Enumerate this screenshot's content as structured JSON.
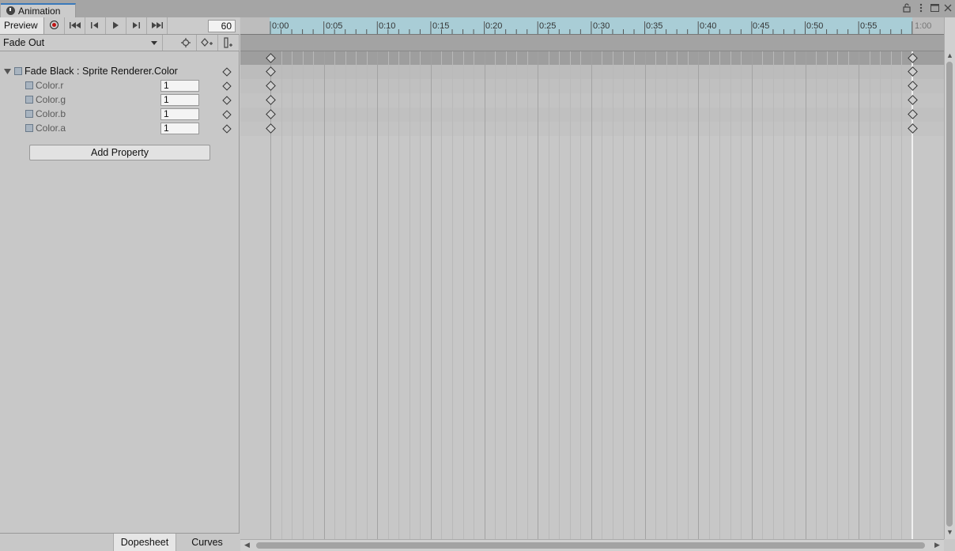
{
  "window": {
    "tab_label": "Animation",
    "tab_icon": "animation-clock-icon"
  },
  "toolbar": {
    "preview_label": "Preview",
    "frame_value": "60",
    "icons": [
      "record-icon",
      "first-keyframe-icon",
      "prev-keyframe-icon",
      "play-icon",
      "next-keyframe-icon",
      "last-keyframe-icon"
    ]
  },
  "clip": {
    "selected": "Fade Out"
  },
  "properties": {
    "group_label": "Fade Black : Sprite Renderer.Color",
    "items": [
      {
        "label": "Color.r",
        "value": "1"
      },
      {
        "label": "Color.g",
        "value": "1"
      },
      {
        "label": "Color.b",
        "value": "1"
      },
      {
        "label": "Color.a",
        "value": "1"
      }
    ],
    "add_label": "Add Property"
  },
  "bottom_tabs": {
    "dopesheet": "Dopesheet",
    "curves": "Curves"
  },
  "timeline": {
    "tick_labels": [
      "0:00",
      "0:05",
      "0:10",
      "0:15",
      "0:20",
      "0:25",
      "0:30",
      "0:35",
      "0:40",
      "0:45",
      "0:50",
      "0:55",
      "1:00"
    ],
    "keyframe_times": [
      "0:00",
      "1:00"
    ]
  },
  "colors": {
    "accent": "#3a79bb",
    "record": "#c01414",
    "ruler": "#a9cdd6"
  }
}
